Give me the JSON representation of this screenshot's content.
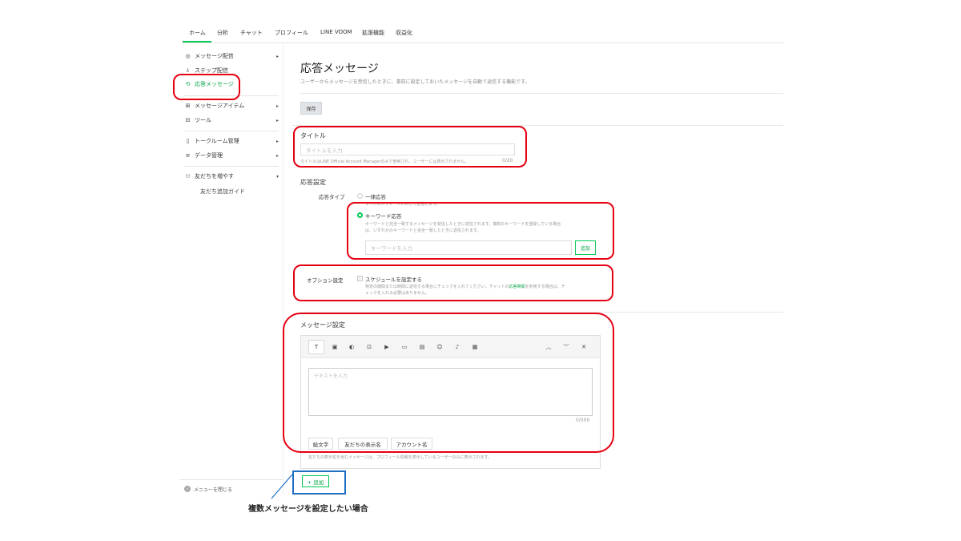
{
  "top_nav": {
    "tabs": [
      "ホーム",
      "分析",
      "チャット",
      "プロフィール",
      "LINE VOOM",
      "拡張機能",
      "収益化"
    ],
    "active": "ホーム"
  },
  "sidebar": {
    "items": [
      {
        "label": "メッセージ配信",
        "icon": "megaphone-icon",
        "caret": "▸"
      },
      {
        "label": "ステップ配信",
        "icon": "step-icon",
        "caret": ""
      },
      {
        "label": "応答メッセージ",
        "icon": "reply-icon",
        "caret": ""
      },
      {
        "label": "メッセージアイテム",
        "icon": "item-icon",
        "caret": "▸"
      },
      {
        "label": "ツール",
        "icon": "tool-icon",
        "caret": "▸"
      },
      {
        "label": "トークルーム管理",
        "icon": "chatroom-icon",
        "caret": "▸"
      },
      {
        "label": "データ管理",
        "icon": "database-icon",
        "caret": "▸"
      },
      {
        "label": "友だちを増やす",
        "icon": "add-friend-icon",
        "caret": "▾"
      }
    ],
    "sub_item": "友だち追加ガイド",
    "footer": "メニューを閉じる"
  },
  "main": {
    "title": "応答メッセージ",
    "description": "ユーザーからメッセージを受信したときに、事前に設定しておいたメッセージを自動で返信する機能です。",
    "save_label": "保存",
    "title_section": {
      "label": "タイトル",
      "placeholder": "タイトルを入力",
      "note": "タイトルはLINE Official Account Managerのみで使用され、ユーザーには表示されません。",
      "count": "0/20"
    },
    "response_settings": {
      "label": "応答設定",
      "type_label": "応答タイプ",
      "option_all": "一律応答",
      "option_all_note": "すべてのメッセージに対して返信します。",
      "option_keyword": "キーワード応答",
      "option_keyword_note1": "キーワードと完全一致するメッセージを受信したときに返信されます。複数のキーワードを登録している場合",
      "option_keyword_note2": "は、いずれかのキーワードと完全一致したときに返信されます。",
      "keyword_placeholder": "キーワードを入力",
      "keyword_add": "追加"
    },
    "options": {
      "label": "オプション設定",
      "schedule": "スケジュールを設定する",
      "note1": "特定の期間または時間に返信する場合にチェックを入れてください。チャットの",
      "note_link": "応答時間",
      "note2": "を利用する場合は、チ",
      "note3": "ェックを入れる必要はありません。"
    },
    "message_settings": {
      "label": "メッセージ設定",
      "placeholder": "テキストを入力",
      "count": "0/500",
      "chips": [
        "絵文字",
        "友だちの表示名",
        "アカウント名"
      ],
      "footnote": "友だちの表示名を含むメッセージは、プロフィール情報を表示しているユーザーのみに表示されます。"
    },
    "add_label": "+ 追加"
  },
  "annotation": "複数メッセージを設定したい場合",
  "colors": {
    "accent": "#06c755",
    "annotation_red": "#e60012",
    "annotation_blue": "#1f6fc5"
  }
}
